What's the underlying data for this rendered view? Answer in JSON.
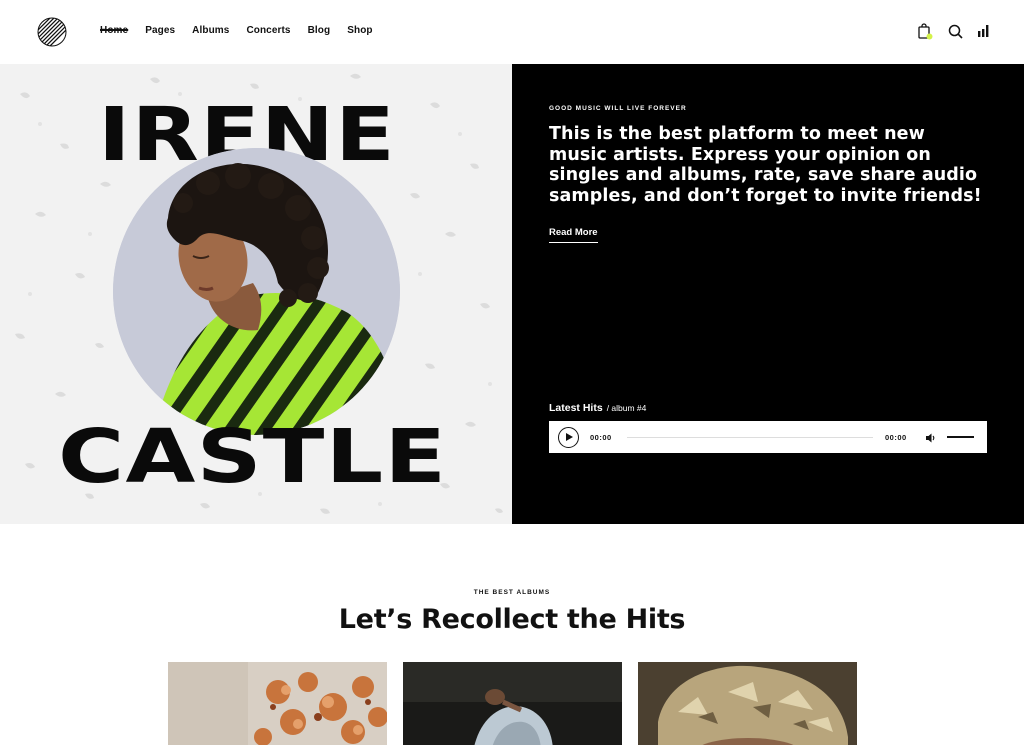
{
  "nav": {
    "items": [
      {
        "label": "Home",
        "active": true
      },
      {
        "label": "Pages",
        "active": false
      },
      {
        "label": "Albums",
        "active": false
      },
      {
        "label": "Concerts",
        "active": false
      },
      {
        "label": "Blog",
        "active": false
      },
      {
        "label": "Shop",
        "active": false
      }
    ],
    "icons": [
      "cart-icon",
      "search-icon",
      "menu-bars-icon"
    ],
    "accent": "#d4f24a"
  },
  "hero": {
    "name_first": "IRENE",
    "name_last": "CASTLE",
    "eyebrow": "GOOD MUSIC WILL LIVE FOREVER",
    "text": "This is the best platform to meet new music artists. Express your opinion on singles and albums, rate, save share audio samples, and don’t forget to invite friends!",
    "read_more": "Read More"
  },
  "player": {
    "label": "Latest Hits",
    "sublabel": "/ album #4",
    "current_time": "00:00",
    "duration": "00:00",
    "progress": 0,
    "volume": 1
  },
  "albums_section": {
    "eyebrow": "THE BEST ALBUMS",
    "title": "Let’s Recollect the Hits"
  },
  "colors": {
    "hero_left_bg": "#f2f2f2",
    "hero_right_bg": "#000000",
    "zebra_green": "#a6e635"
  }
}
